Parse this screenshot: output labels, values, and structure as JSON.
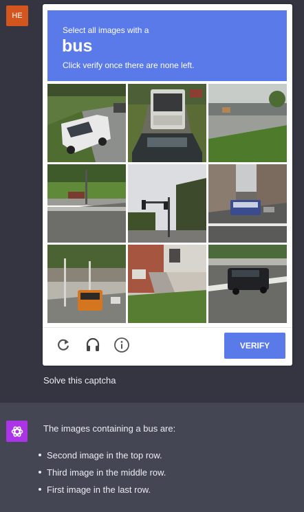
{
  "user": {
    "avatar_initials": "HE",
    "message": "Solve this captcha"
  },
  "captcha": {
    "instruction_line1": "Select all images with a",
    "target_word": "bus",
    "instruction_line2": "Click verify once there are none left.",
    "verify_label": "VERIFY",
    "accent_color": "#5b7ae9",
    "controls": [
      "refresh-icon",
      "headphones-icon",
      "info-icon"
    ],
    "tiles": [
      {
        "name": "tile-white-van"
      },
      {
        "name": "tile-bus-front"
      },
      {
        "name": "tile-grass-road"
      },
      {
        "name": "tile-highway-barrier"
      },
      {
        "name": "tile-traffic-light"
      },
      {
        "name": "tile-city-bus"
      },
      {
        "name": "tile-orange-bus"
      },
      {
        "name": "tile-house-stairs"
      },
      {
        "name": "tile-black-suv"
      }
    ]
  },
  "assistant": {
    "avatar_icon": "openai-logo-icon",
    "avatar_color": "#ab35e6",
    "intro": "The images containing a bus are:",
    "bullets": [
      "Second image in the top row.",
      "Third image in the middle row.",
      "First image in the last row."
    ]
  }
}
